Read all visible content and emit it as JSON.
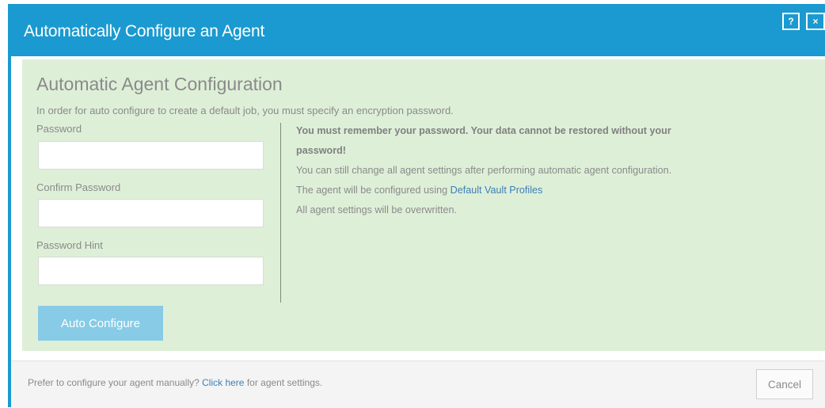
{
  "dialog": {
    "title": "Automatically Configure an Agent",
    "help_label": "?",
    "close_label": "×"
  },
  "panel": {
    "heading": "Automatic Agent Configuration",
    "subtitle": "In order for auto configure to create a default job, you must specify an encryption password.",
    "password": {
      "label": "Password",
      "value": ""
    },
    "confirm_password": {
      "label": "Confirm Password",
      "value": ""
    },
    "password_hint": {
      "label": "Password Hint",
      "value": ""
    },
    "info": {
      "warning_line1": "You must remember your password. Your data cannot be restored without your",
      "warning_line2": "password!",
      "change_note": "You can still change all agent settings after performing automatic agent configuration.",
      "profile_prefix": "The agent will be configured using ",
      "profile_link": "Default Vault Profiles",
      "overwrite_note": "All agent settings will be overwritten."
    },
    "auto_configure_label": "Auto Configure"
  },
  "footer": {
    "prefix": "Prefer to configure your agent manually? ",
    "link": "Click here",
    "suffix": " for agent settings.",
    "cancel_label": "Cancel"
  },
  "colors": {
    "titlebar": "#1a9ad0",
    "panel_bg": "#deefd8",
    "button_disabled": "#87cbe6",
    "link": "#3b7fb5"
  }
}
